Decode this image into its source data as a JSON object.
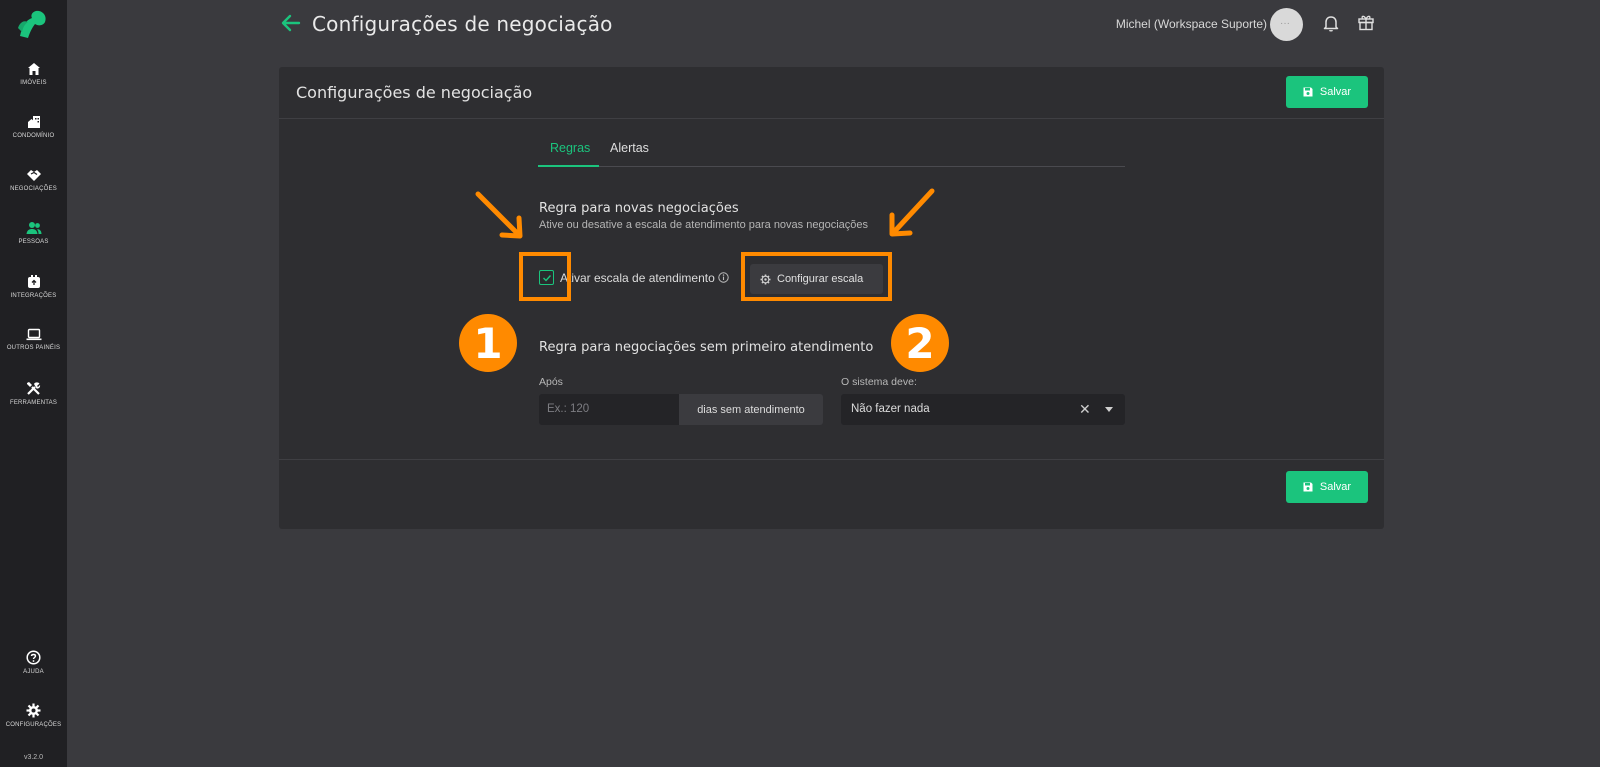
{
  "sidebar": {
    "items": [
      {
        "label": "IMÓVEIS",
        "icon": "home-icon"
      },
      {
        "label": "CONDOMÍNIO",
        "icon": "building-icon"
      },
      {
        "label": "NEGOCIAÇÕES",
        "icon": "handshake-icon"
      },
      {
        "label": "PESSOAS",
        "icon": "people-icon"
      },
      {
        "label": "INTEGRAÇÕES",
        "icon": "integration-icon"
      },
      {
        "label": "OUTROS PAINÉIS",
        "icon": "laptop-icon"
      },
      {
        "label": "FERRAMENTAS",
        "icon": "tools-icon"
      }
    ],
    "bottom": [
      {
        "label": "AJUDA",
        "icon": "help-icon"
      },
      {
        "label": "CONFIGURAÇÕES",
        "icon": "settings-icon"
      }
    ],
    "version": "v3.2.0"
  },
  "header": {
    "title": "Configurações de negociação",
    "user": "Michel (Workspace Suporte)",
    "avatar_text": "···"
  },
  "card": {
    "title": "Configurações de negociação",
    "save_label": "Salvar",
    "tabs": [
      {
        "label": "Regras",
        "active": true
      },
      {
        "label": "Alertas",
        "active": false
      }
    ],
    "section1": {
      "title": "Regra para novas negociações",
      "subtitle": "Ative ou desative a escala de atendimento para novas negociações",
      "checkbox_label": "Ativar escala de atendimento",
      "checkbox_checked": true,
      "config_button": "Configurar escala"
    },
    "section2": {
      "title": "Regra para negociações sem primeiro atendimento",
      "after_label": "Após",
      "days_placeholder": "Ex.: 120",
      "days_addon": "dias sem atendimento",
      "system_label": "O sistema deve:",
      "system_value": "Não fazer nada"
    }
  },
  "annotations": {
    "badge1": "1",
    "badge2": "2"
  },
  "colors": {
    "accent": "#1bc47d",
    "highlight": "#ff8a00",
    "background": "#3a3a3e",
    "sidebar": "#202023",
    "card": "#2e2e31"
  }
}
